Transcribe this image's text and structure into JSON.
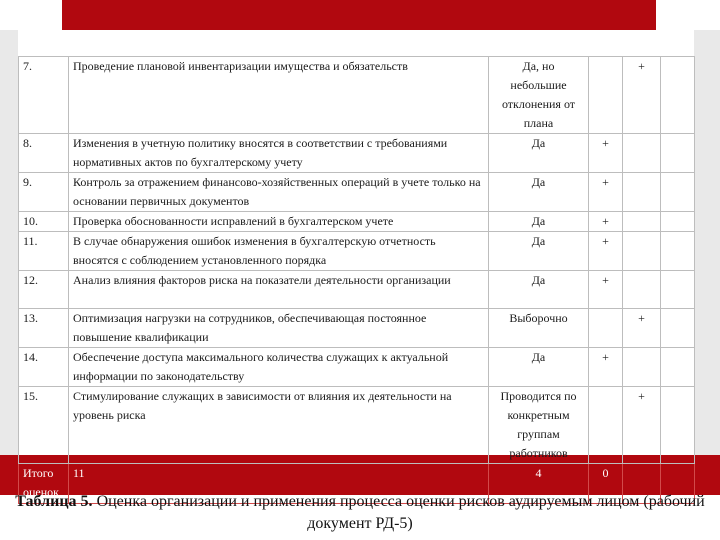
{
  "rows": [
    {
      "num": "7.",
      "text": "Проведение плановой инвентаризации имущества и обязательств",
      "result": "Да, но небольшие отклонения от плана",
      "mark_a": "",
      "mark_b": "+"
    },
    {
      "num": "8.",
      "text": "Изменения в учетную политику вносятся в соответствии с требованиями нормативных актов по бухгалтерскому учету",
      "result": "Да",
      "mark_a": "+",
      "mark_b": ""
    },
    {
      "num": "9.",
      "text": "Контроль за отражением финансово-хозяйственных операций в учете только на основании первичных документов",
      "result": "Да",
      "mark_a": "+",
      "mark_b": ""
    },
    {
      "num": "10.",
      "text": "Проверка обоснованности исправлений в бухгалтерском учете",
      "result": "Да",
      "mark_a": "+",
      "mark_b": ""
    },
    {
      "num": "11.",
      "text": "В случае обнаружения ошибок изменения в бухгалтерскую отчетность вносятся с соблюдением установленного порядка",
      "result": "Да",
      "mark_a": "+",
      "mark_b": ""
    },
    {
      "num": "12.",
      "text": "Анализ влияния факторов риска на показатели деятельности организации",
      "result": "Да",
      "mark_a": "+",
      "mark_b": ""
    },
    {
      "num": "13.",
      "text": "Оптимизация нагрузки на сотрудников, обеспечивающая постоянное повышение квалификации",
      "result": "Выборочно",
      "mark_a": "",
      "mark_b": "+"
    },
    {
      "num": "14.",
      "text": "Обеспечение доступа максимального количества служащих к актуальной информации по законодательству",
      "result": "Да",
      "mark_a": "+",
      "mark_b": ""
    },
    {
      "num": "15.",
      "text": "Стимулирование служащих в зависимости от влияния их деятельности на уровень риска",
      "result": "Проводится по конкретным группам работников",
      "mark_a": "",
      "mark_b": "+"
    }
  ],
  "total": {
    "label": "Итого оценок",
    "text": "11",
    "result": "4",
    "mark_a": "0",
    "mark_b": ""
  },
  "caption": {
    "bold": "Таблица 5.",
    "text": " Оценка организации и применения процесса оценки рисков аудируемым лицом (рабочий документ РД-5)"
  }
}
